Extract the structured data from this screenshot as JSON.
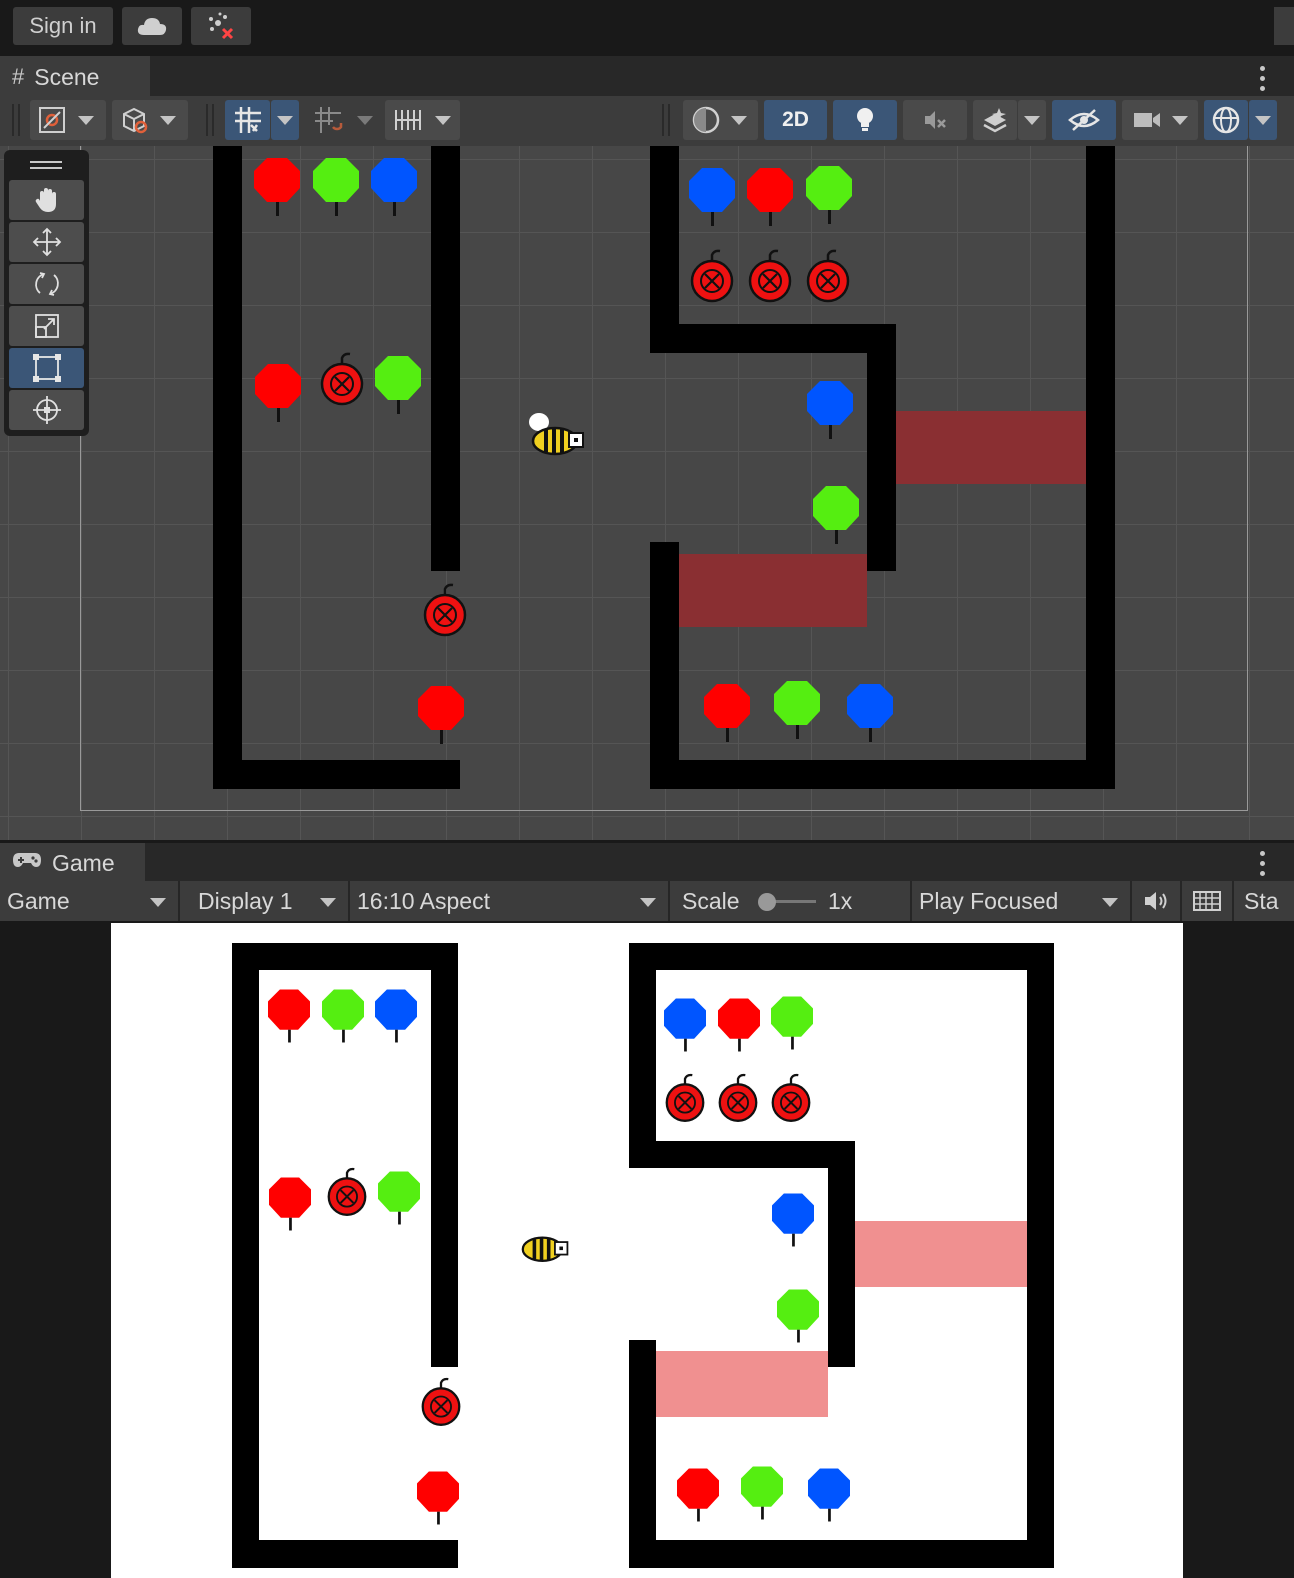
{
  "topbar": {
    "sign_in_label": "Sign in",
    "cloud_icon": "cloud-icon",
    "collab_icon": "collab-disconnected-icon"
  },
  "scene": {
    "tab_label": "Scene",
    "tab_icon": "grid-hash-icon",
    "toolbar": {
      "view_2d_label": "2D",
      "buttons": [
        "draw-mode",
        "shading-mode",
        "grid-snapping",
        "increment-snap",
        "grid-visibility",
        "render-mode",
        "2d-toggle",
        "lighting",
        "audio",
        "effects",
        "scene-visibility",
        "camera",
        "gizmos"
      ]
    },
    "tools": [
      "hand-tool",
      "move-tool",
      "rotate-tool",
      "scale-tool",
      "rect-tool",
      "transform-tool"
    ],
    "active_tool": "rect-tool"
  },
  "game": {
    "tab_label": "Game",
    "tab_icon": "gamepad-icon",
    "toolbar": {
      "view_select": "Game",
      "display_select": "Display 1",
      "aspect_select": "16:10 Aspect",
      "scale_label": "Scale",
      "scale_value": "1x",
      "scale_slider_fraction": 0,
      "play_mode_select": "Play Focused",
      "stats_label": "Sta"
    }
  },
  "colors": {
    "balloon_red": "#ff0000",
    "balloon_green": "#55ee11",
    "balloon_blue": "#0055ff",
    "bomb": "#ee1111",
    "zone_scene": "#8a2f32",
    "zone_game": "#f09090",
    "selection_blue": "#3b5677"
  },
  "level": {
    "balloons": [
      {
        "color": "red",
        "group": "left-top"
      },
      {
        "color": "green",
        "group": "left-top"
      },
      {
        "color": "blue",
        "group": "left-top"
      },
      {
        "color": "red",
        "group": "left-mid"
      },
      {
        "color": "green",
        "group": "left-mid"
      },
      {
        "color": "red",
        "group": "left-bottom"
      },
      {
        "color": "blue",
        "group": "right-top"
      },
      {
        "color": "red",
        "group": "right-top"
      },
      {
        "color": "green",
        "group": "right-top"
      },
      {
        "color": "blue",
        "group": "right-mid"
      },
      {
        "color": "green",
        "group": "right-mid"
      },
      {
        "color": "red",
        "group": "right-bottom"
      },
      {
        "color": "green",
        "group": "right-bottom"
      },
      {
        "color": "blue",
        "group": "right-bottom"
      }
    ],
    "bombs": 5,
    "player": "bee"
  }
}
